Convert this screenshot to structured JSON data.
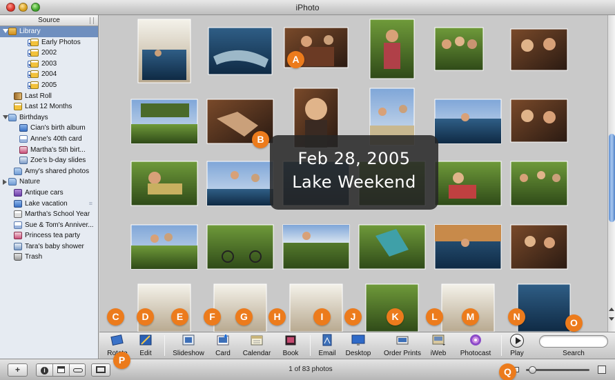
{
  "window": {
    "title": "iPhoto"
  },
  "sidebar": {
    "header": "Source",
    "items": [
      {
        "label": "Library",
        "icon": "library-icon",
        "indent": 0,
        "tri": "down",
        "selected": true,
        "check": false
      },
      {
        "label": "Early Photos",
        "icon": "calendar-folder-icon",
        "indent": 2,
        "check": true
      },
      {
        "label": "2002",
        "icon": "calendar-folder-icon",
        "indent": 2,
        "check": true
      },
      {
        "label": "2003",
        "icon": "calendar-folder-icon",
        "indent": 2,
        "check": true
      },
      {
        "label": "2004",
        "icon": "calendar-folder-icon",
        "indent": 2,
        "check": true
      },
      {
        "label": "2005",
        "icon": "calendar-folder-icon",
        "indent": 2,
        "check": true
      },
      {
        "label": "Last Roll",
        "icon": "last-roll-icon",
        "indent": 1
      },
      {
        "label": "Last 12 Months",
        "icon": "calendar-folder-icon",
        "indent": 1
      },
      {
        "label": "Birthdays",
        "icon": "folder-icon",
        "indent": 0,
        "tri": "down"
      },
      {
        "label": "Cian's birth album",
        "icon": "album-icon",
        "indent": 2
      },
      {
        "label": "Anne's 40th card",
        "icon": "card-icon",
        "indent": 2
      },
      {
        "label": "Martha's 5th birt...",
        "icon": "book-icon",
        "indent": 2
      },
      {
        "label": "Zoe's b-day slides",
        "icon": "slideshow-icon",
        "indent": 2
      },
      {
        "label": "Amy's shared photos",
        "icon": "folder-icon",
        "indent": 1
      },
      {
        "label": "Nature",
        "icon": "folder-icon",
        "indent": 0,
        "tri": "right"
      },
      {
        "label": "Antique cars",
        "icon": "smart-album-icon",
        "indent": 1
      },
      {
        "label": "Lake vacation",
        "icon": "album-icon",
        "indent": 1,
        "shared": true
      },
      {
        "label": "Martha's School Year",
        "icon": "calendar-book-icon",
        "indent": 1
      },
      {
        "label": "Sue & Tom's Anniver...",
        "icon": "card-icon",
        "indent": 1
      },
      {
        "label": "Princess tea party",
        "icon": "book-icon",
        "indent": 1
      },
      {
        "label": "Tara's baby shower",
        "icon": "slideshow-icon",
        "indent": 1
      },
      {
        "label": "Trash",
        "icon": "trash-icon",
        "indent": 1
      }
    ]
  },
  "overlay": {
    "line1": "Feb 28, 2005",
    "line2": "Lake Weekend"
  },
  "toolbar": {
    "buttons": [
      {
        "label": "Rotate",
        "icon": "rotate-icon",
        "name": "rotate-button"
      },
      {
        "label": "Edit",
        "icon": "edit-icon",
        "name": "edit-button"
      },
      {
        "label": "Slideshow",
        "icon": "slideshow-icon",
        "name": "slideshow-button"
      },
      {
        "label": "Card",
        "icon": "card-icon",
        "name": "card-button"
      },
      {
        "label": "Calendar",
        "icon": "calendar-icon",
        "name": "calendar-button"
      },
      {
        "label": "Book",
        "icon": "book-icon",
        "name": "book-button"
      },
      {
        "label": "Email",
        "icon": "email-icon",
        "name": "email-button"
      },
      {
        "label": "Desktop",
        "icon": "desktop-icon",
        "name": "desktop-button"
      },
      {
        "label": "Order Prints",
        "icon": "order-prints-icon",
        "name": "order-prints-button"
      },
      {
        "label": "iWeb",
        "icon": "iweb-icon",
        "name": "iweb-button"
      },
      {
        "label": "Photocast",
        "icon": "photocast-icon",
        "name": "photocast-button"
      },
      {
        "label": "Play",
        "icon": "play-icon",
        "name": "play-button"
      }
    ],
    "search_label": "Search",
    "search_value": ""
  },
  "bottombar": {
    "add_label": "+",
    "info_label": "i",
    "status": "1 of 83 photos",
    "zoom_level": 0.1
  },
  "callouts": [
    "A",
    "B",
    "C",
    "D",
    "E",
    "F",
    "G",
    "H",
    "I",
    "J",
    "K",
    "L",
    "M",
    "N",
    "O",
    "P",
    "Q"
  ],
  "colors": {
    "accent": "#ec7b1c",
    "selection": "#6f8fbf",
    "sidebar_bg": "#e6ebf2",
    "canvas_bg": "#c9c9c9"
  }
}
